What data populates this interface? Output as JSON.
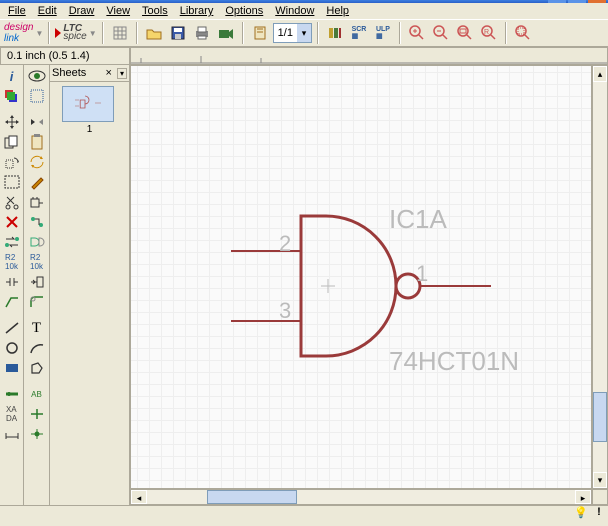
{
  "menu": {
    "file": "File",
    "edit": "Edit",
    "draw": "Draw",
    "view": "View",
    "tools": "Tools",
    "library": "Library",
    "options": "Options",
    "window": "Window",
    "help": "Help"
  },
  "logos": {
    "design": "design",
    "link": "link",
    "ltc": "LTC",
    "spice": "spice"
  },
  "toolbar": {
    "page": "1/1"
  },
  "sheets": {
    "title": "Sheets",
    "thumb1_label": "1"
  },
  "coords": {
    "readout": "0.1 inch (0.5 1.4)"
  },
  "component": {
    "ref": "IC1A",
    "value": "74HCT01N",
    "pin_out": "1",
    "pin_in_top": "2",
    "pin_in_bot": "3"
  },
  "status": {
    "bulb": "💡",
    "excl": "!"
  }
}
